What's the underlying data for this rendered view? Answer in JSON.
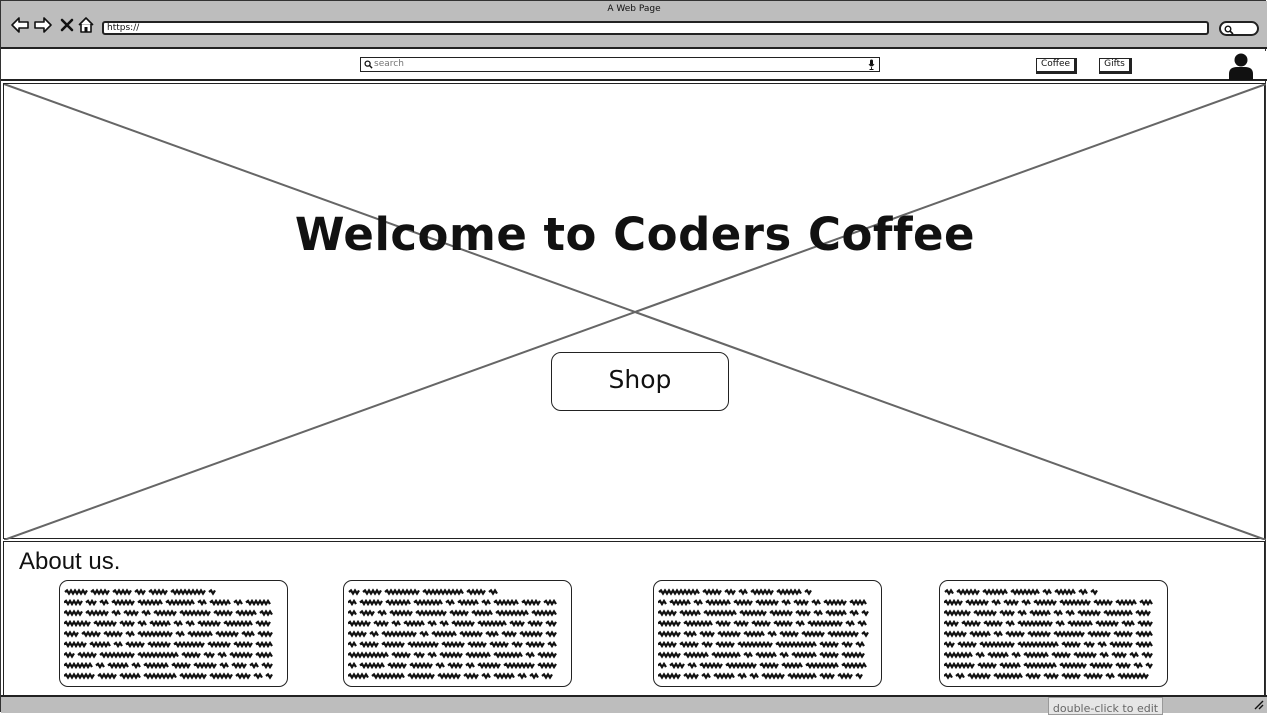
{
  "browser": {
    "window_title": "A Web Page",
    "url": "https://",
    "icons": [
      "back-arrow-icon",
      "forward-arrow-icon",
      "close-x-icon",
      "home-icon",
      "search-icon"
    ]
  },
  "header": {
    "search_placeholder": "search",
    "nav": [
      {
        "label": "Coffee"
      },
      {
        "label": "Gifts"
      }
    ],
    "icons": [
      "magnifier-icon",
      "microphone-icon",
      "user-avatar-icon"
    ]
  },
  "hero": {
    "title": "Welcome to Coders Coffee",
    "button_label": "Shop",
    "placeholder": "image-placeholder-x"
  },
  "about": {
    "heading": "About us.",
    "cards": [
      {
        "content": "scribbled placeholder text"
      },
      {
        "content": "scribbled placeholder text"
      },
      {
        "content": "scribbled placeholder text"
      },
      {
        "content": "scribbled placeholder text"
      }
    ]
  },
  "status": {
    "hint": "double-click to edit"
  },
  "colors": {
    "chrome": "#bdbdbd",
    "ink": "#222222",
    "placeholder_line": "#666666"
  }
}
